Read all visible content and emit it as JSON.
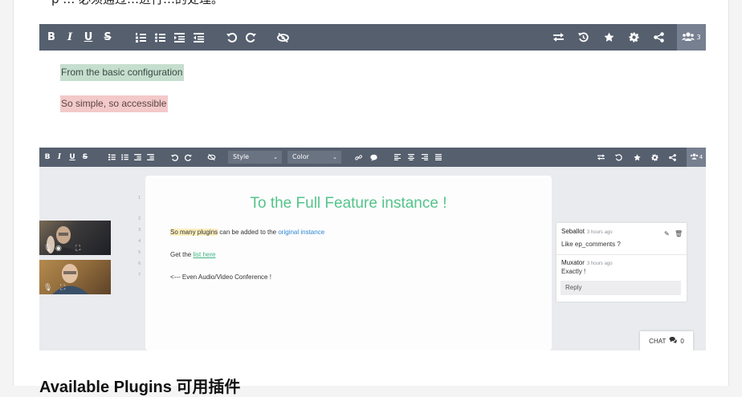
{
  "top_cut_text": "p … 必须通过…进行…的处理。",
  "toolbar": {
    "bold": "B",
    "italic": "I",
    "underline": "U",
    "strike": "S",
    "ordered_list": "ordered-list-icon",
    "bullet_list": "bullet-list-icon",
    "indent": "indent-icon",
    "outdent": "outdent-icon",
    "undo": "undo-icon",
    "redo": "redo-icon",
    "hide": "eye-slash-icon",
    "swap": "swap-icon",
    "history": "history-icon",
    "star": "star-icon",
    "settings": "gear-icon",
    "share": "share-icon",
    "users_count": "3"
  },
  "editor": {
    "line1": "From the basic configuration",
    "line2": "So simple, so accessible"
  },
  "full_editor": {
    "style_select": "Style",
    "color_select": "Color",
    "users_count": "4",
    "title": "To the Full Feature instance !",
    "line_numbers": [
      "1",
      "2",
      "3",
      "4",
      "5",
      "6",
      "7"
    ],
    "plugins_highlight": "So many plugins",
    "plugins_mid": " can be added to the ",
    "plugins_link": "original instance",
    "get_the": "Get the ",
    "list_link": "list here",
    "audio_video": "<--- Even Audio/Video Conference !",
    "comments": [
      {
        "author": "Seballot",
        "time": "3 hours ago",
        "text": "Like ep_comments ?"
      },
      {
        "author": "Muxator",
        "time": "3 hours ago",
        "text": "Exactly !"
      }
    ],
    "reply_label": "Reply",
    "chat_label": "CHAT",
    "chat_count": "0"
  },
  "section_heading": "Available Plugins 可用插件"
}
